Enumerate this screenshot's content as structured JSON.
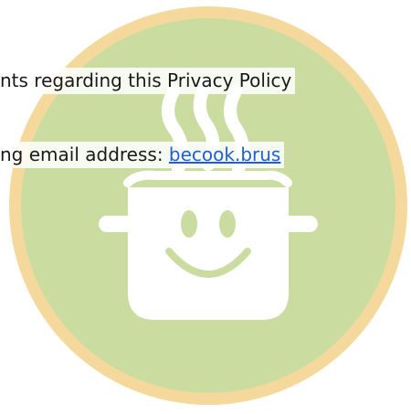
{
  "content": {
    "line1_text": "nts regarding this Privacy Policy",
    "line2_prefix": "ng email address: ",
    "email_link": "becook.brus"
  },
  "colors": {
    "outer_ring": "#f4d9a0",
    "inner_circle": "#cbdca0",
    "pot": "#ffffff",
    "text": "#1a1a1a",
    "link": "#1d5fd6"
  },
  "icons": [
    "cooking-pot-logo-watermark"
  ]
}
